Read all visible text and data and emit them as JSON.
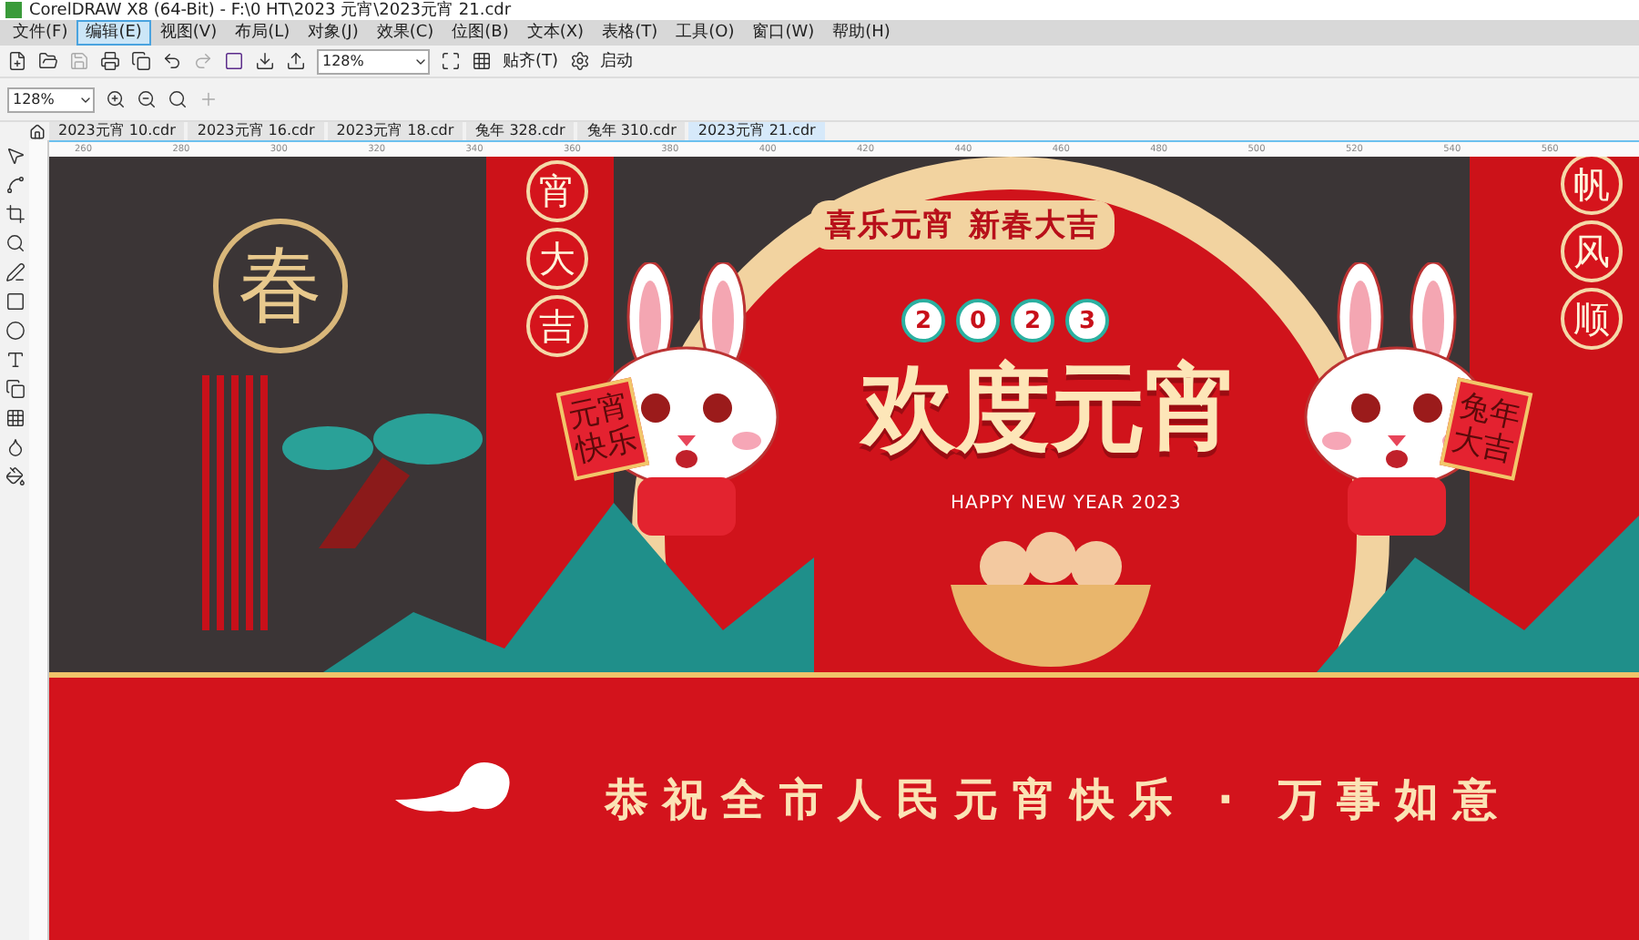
{
  "window": {
    "title": "CorelDRAW X8 (64-Bit) - F:\\0 HT\\2023 元宵\\2023元宵 21.cdr"
  },
  "menu": [
    {
      "label": "文件(F)",
      "selected": false
    },
    {
      "label": "编辑(E)",
      "selected": true
    },
    {
      "label": "视图(V)",
      "selected": false
    },
    {
      "label": "布局(L)",
      "selected": false
    },
    {
      "label": "对象(J)",
      "selected": false
    },
    {
      "label": "效果(C)",
      "selected": false
    },
    {
      "label": "位图(B)",
      "selected": false
    },
    {
      "label": "文本(X)",
      "selected": false
    },
    {
      "label": "表格(T)",
      "selected": false
    },
    {
      "label": "工具(O)",
      "selected": false
    },
    {
      "label": "窗口(W)",
      "selected": false
    },
    {
      "label": "帮助(H)",
      "selected": false
    }
  ],
  "toolbar": {
    "zoom": "128%",
    "snap": "贴齐(T)",
    "launch": "启动"
  },
  "property_bar": {
    "zoom": "128%"
  },
  "tabs": [
    {
      "label": "2023元宵 10.cdr",
      "selected": false
    },
    {
      "label": "2023元宵 16.cdr",
      "selected": false
    },
    {
      "label": "2023元宵 18.cdr",
      "selected": false
    },
    {
      "label": "兔年 328.cdr",
      "selected": false
    },
    {
      "label": "兔年 310.cdr",
      "selected": false
    },
    {
      "label": "2023元宵 21.cdr",
      "selected": true
    }
  ],
  "ruler": {
    "labels": [
      "260",
      "280",
      "300",
      "320",
      "340",
      "360",
      "380",
      "400",
      "420",
      "440",
      "460",
      "480",
      "500",
      "520",
      "540",
      "560"
    ]
  },
  "artwork": {
    "badge": "春",
    "left_couplet": [
      "宵",
      "大",
      "吉"
    ],
    "right_couplet": [
      "帆",
      "风",
      "顺"
    ],
    "arch_text": "喜乐元宵 新春大吉",
    "year_digits": [
      "2",
      "0",
      "2",
      "3"
    ],
    "headline": "欢度元宵",
    "subtitle": "HAPPY NEW YEAR 2023",
    "left_scroll": "元宵快乐",
    "right_scroll": "兔年大吉",
    "banner": "恭祝全市人民元宵快乐 · 万事如意"
  }
}
